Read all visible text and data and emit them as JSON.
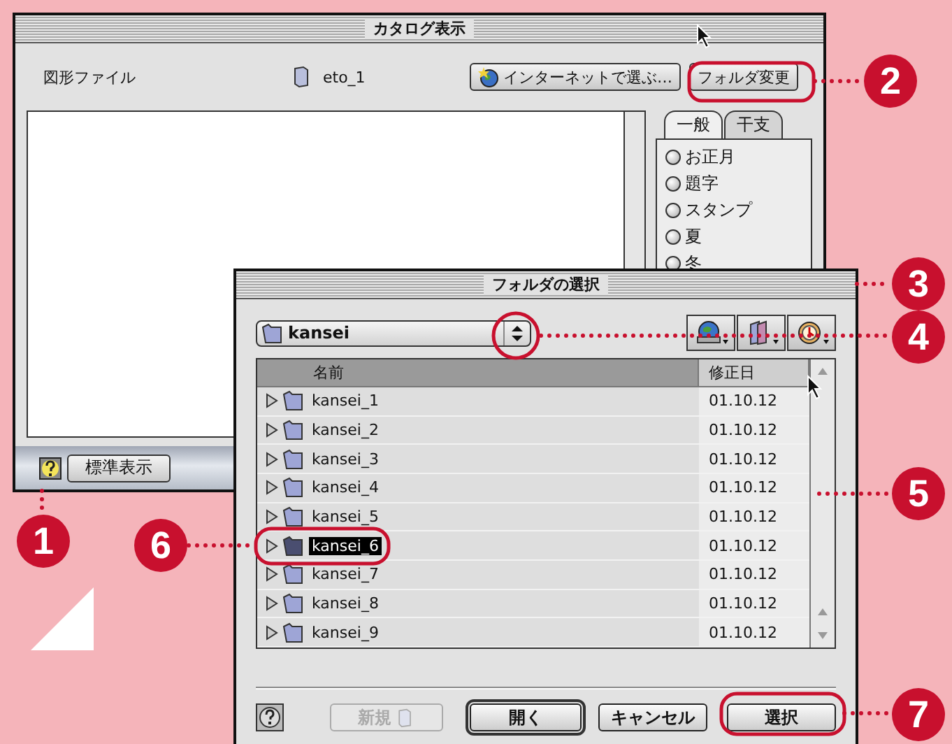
{
  "catalog_window": {
    "title": "カタログ表示",
    "file_label": "図形ファイル",
    "file_name": "eto_1",
    "internet_button": "インターネットで選ぶ…",
    "folder_button": "フォルダ変更",
    "tabs": [
      {
        "label": "一般",
        "selected": true
      },
      {
        "label": "干支",
        "selected": false
      }
    ],
    "categories": [
      {
        "label": "お正月",
        "selected": false
      },
      {
        "label": "題字",
        "selected": false
      },
      {
        "label": "スタンプ",
        "selected": false
      },
      {
        "label": "夏",
        "selected": false
      },
      {
        "label": "冬",
        "selected": false
      }
    ],
    "standard_button": "標準表示"
  },
  "folder_dialog": {
    "title": "フォルダの選択",
    "location": "kansei",
    "columns": [
      {
        "label": "名前",
        "selected": true
      },
      {
        "label": "修正日",
        "selected": false
      }
    ],
    "rows": [
      {
        "name": "kansei_1",
        "date": "01.10.12",
        "selected": false
      },
      {
        "name": "kansei_2",
        "date": "01.10.12",
        "selected": false
      },
      {
        "name": "kansei_3",
        "date": "01.10.12",
        "selected": false
      },
      {
        "name": "kansei_4",
        "date": "01.10.12",
        "selected": false
      },
      {
        "name": "kansei_5",
        "date": "01.10.12",
        "selected": false
      },
      {
        "name": "kansei_6",
        "date": "01.10.12",
        "selected": true
      },
      {
        "name": "kansei_7",
        "date": "01.10.12",
        "selected": false
      },
      {
        "name": "kansei_8",
        "date": "01.10.12",
        "selected": false
      },
      {
        "name": "kansei_9",
        "date": "01.10.12",
        "selected": false
      }
    ],
    "buttons": [
      {
        "label": "新規",
        "kind": "new",
        "disabled": true,
        "default": false
      },
      {
        "label": "開く",
        "kind": "open",
        "disabled": false,
        "default": true
      },
      {
        "label": "キャンセル",
        "kind": "cancel",
        "disabled": false,
        "default": false
      },
      {
        "label": "選択",
        "kind": "choose",
        "disabled": false,
        "default": false
      }
    ]
  },
  "callouts": [
    "1",
    "2",
    "3",
    "4",
    "5",
    "6",
    "7"
  ]
}
